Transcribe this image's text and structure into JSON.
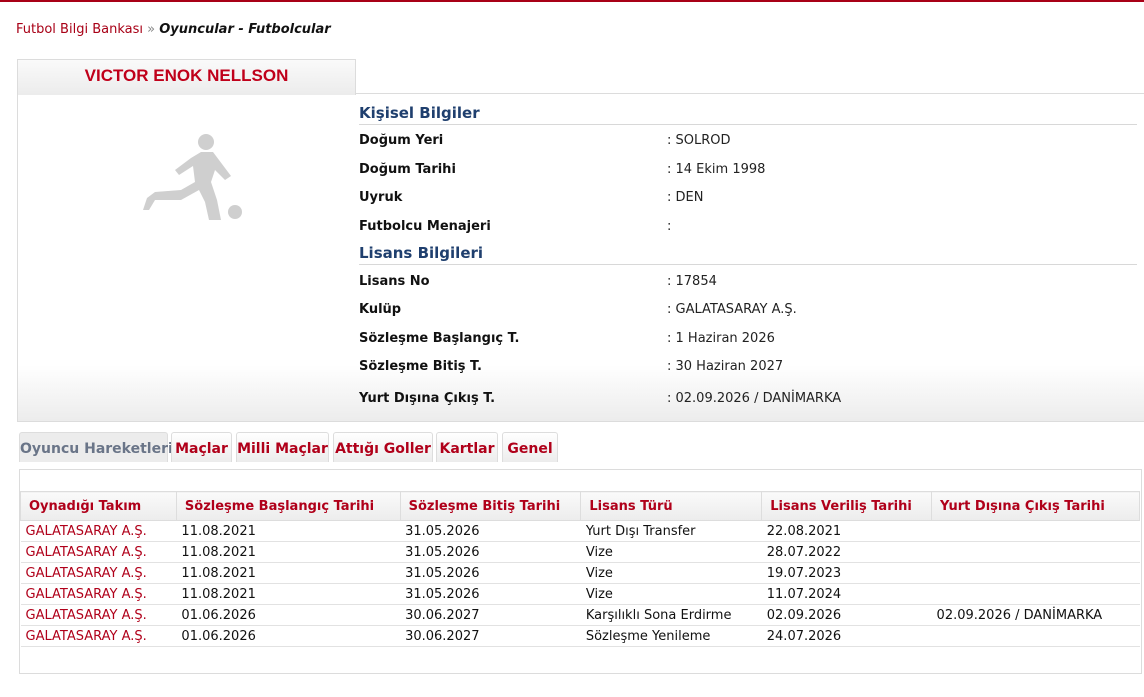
{
  "breadcrumb": {
    "home": "Futbol Bilgi Bankası",
    "separator": "»",
    "current": "Oyuncular - Futbolcular"
  },
  "player": {
    "name": "VICTOR ENOK NELLSON",
    "photo_icon": "player-silhouette-icon"
  },
  "personal": {
    "title": "Kişisel Bilgiler",
    "rows": [
      {
        "label": "Doğum Yeri",
        "value": ":  SOLROD"
      },
      {
        "label": "Doğum Tarihi",
        "value": ":  14 Ekim 1998"
      },
      {
        "label": "Uyruk",
        "value": ":  DEN"
      },
      {
        "label": "Futbolcu Menajeri",
        "value": ":"
      }
    ]
  },
  "license": {
    "title": "Lisans Bilgileri",
    "rows": [
      {
        "label": "Lisans No",
        "value": ": 17854"
      },
      {
        "label": "Kulüp",
        "value": ": GALATASARAY A.Ş."
      },
      {
        "label": "Sözleşme Başlangıç T.",
        "value": ": 1 Haziran 2026"
      },
      {
        "label": "Sözleşme Bitiş T.",
        "value": ": 30 Haziran 2027"
      },
      {
        "label": "Yurt Dışına Çıkış T.",
        "value": ": 02.09.2026 / DANİMARKA"
      }
    ]
  },
  "tabs": [
    {
      "label": "Oyuncu Hareketleri",
      "active": true
    },
    {
      "label": "Maçlar",
      "active": false
    },
    {
      "label": "Milli Maçlar",
      "active": false
    },
    {
      "label": "Attığı Goller",
      "active": false
    },
    {
      "label": "Kartlar",
      "active": false
    },
    {
      "label": "Genel",
      "active": false
    }
  ],
  "movements": {
    "columns": [
      "Oynadığı Takım",
      "Sözleşme Başlangıç Tarihi",
      "Sözleşme Bitiş Tarihi",
      "Lisans Türü",
      "Lisans Veriliş Tarihi",
      "Yurt Dışına Çıkış Tarihi"
    ],
    "rows": [
      [
        "GALATASARAY A.Ş.",
        "11.08.2021",
        "31.05.2026",
        "Yurt Dışı Transfer",
        "22.08.2021",
        ""
      ],
      [
        "GALATASARAY A.Ş.",
        "11.08.2021",
        "31.05.2026",
        "Vize",
        "28.07.2022",
        ""
      ],
      [
        "GALATASARAY A.Ş.",
        "11.08.2021",
        "31.05.2026",
        "Vize",
        "19.07.2023",
        ""
      ],
      [
        "GALATASARAY A.Ş.",
        "11.08.2021",
        "31.05.2026",
        "Vize",
        "11.07.2024",
        ""
      ],
      [
        "GALATASARAY A.Ş.",
        "01.06.2026",
        "30.06.2027",
        "Karşılıklı Sona Erdirme",
        "02.09.2026",
        "02.09.2026 / DANİMARKA"
      ],
      [
        "GALATASARAY A.Ş.",
        "01.06.2026",
        "30.06.2027",
        "Sözleşme Yenileme",
        "24.07.2026",
        ""
      ]
    ]
  },
  "colors": {
    "accent": "#b0001a",
    "section_title": "#1f3f6e",
    "tab_inactive_text": "#6a7588"
  }
}
